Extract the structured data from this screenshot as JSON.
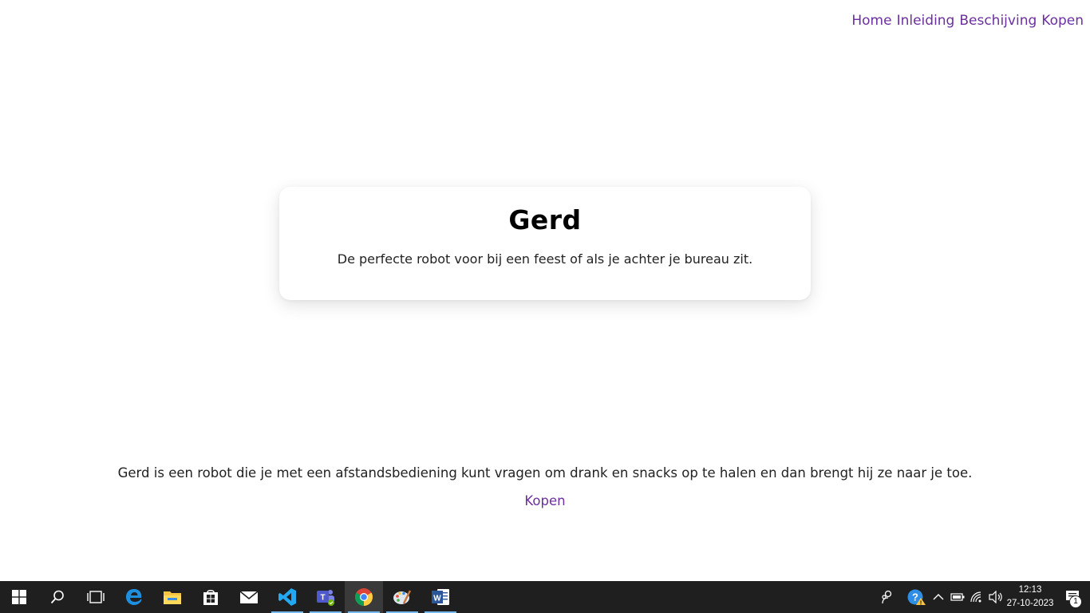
{
  "nav": {
    "items": [
      {
        "label": "Home"
      },
      {
        "label": "Inleiding"
      },
      {
        "label": "Beschijving"
      },
      {
        "label": "Kopen"
      }
    ]
  },
  "hero": {
    "title": "Gerd",
    "subtitle": "De perfecte robot voor bij een feest of als je achter je bureau zit."
  },
  "main": {
    "description": "Gerd is een robot die je met een afstandsbediening kunt vragen om drank en snacks op te halen en dan brengt hij ze naar je toe.",
    "buy_link": "Kopen"
  },
  "colors": {
    "link": "#6b2fa0",
    "taskbar": "#1f1f1f"
  },
  "taskbar": {
    "apps": [
      {
        "icon": "windows-start-icon"
      },
      {
        "icon": "search-icon"
      },
      {
        "icon": "task-view-icon"
      },
      {
        "icon": "edge-icon"
      },
      {
        "icon": "file-explorer-icon"
      },
      {
        "icon": "microsoft-store-icon"
      },
      {
        "icon": "mail-icon"
      },
      {
        "icon": "vscode-icon"
      },
      {
        "icon": "teams-icon"
      },
      {
        "icon": "chrome-icon"
      },
      {
        "icon": "paint-icon"
      },
      {
        "icon": "word-icon"
      }
    ],
    "clock": {
      "time": "12:13",
      "date": "27-10-2023"
    },
    "notification_count": "1"
  }
}
